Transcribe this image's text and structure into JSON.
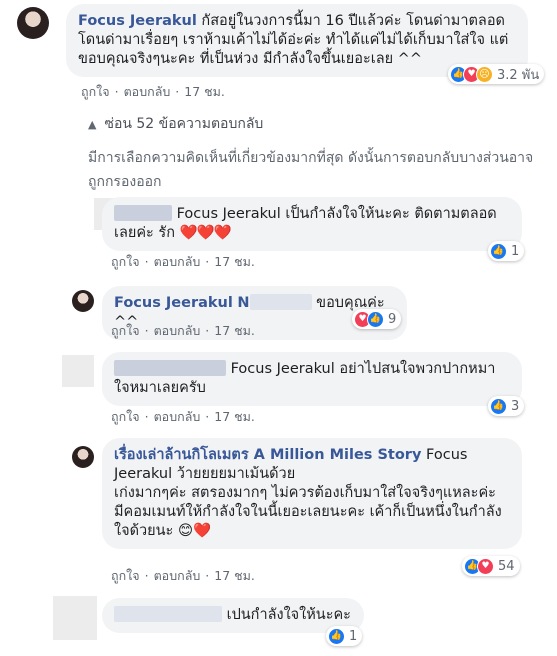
{
  "comment_main": {
    "author": "Focus Jeerakul",
    "text": "กัสอยู่ในวงการนี้มา 16 ปีแล้วค่ะ โดนด่ามาตลอด โดนด่ามาเรื่อยๆ เราห้ามเค้าไม่ได้อ่ะค่ะ ทำได้แค่ไม่ได้เก็บมาใส่ใจ แต่ขอบคุณจริงๆนะคะ ที่เป็นห่วง มีกำลังใจขึ้นเยอะเลย ^^",
    "reaction_count": "3.2 พัน",
    "like": "ถูกใจ",
    "reply": "ตอบกลับ",
    "time": "17 ชม."
  },
  "hidden_replies_link": "ซ่อน 52 ข้อความตอบกลับ",
  "notice": "มีการเลือกความคิดเห็นที่เกี่ยวข้องมากที่สุด ดังนั้นการตอบกลับบางส่วนอาจถูกกรองออก",
  "replies": [
    {
      "mention": "Focus Jeerakul",
      "text": "เป็นกำลังใจให้นะคะ ติดตามตลอดเลยค่ะ รัก",
      "hearts": "❤️❤️❤️",
      "reaction_count": "1",
      "like": "ถูกใจ",
      "reply": "ตอบกลับ",
      "time": "17 ชม."
    },
    {
      "author": "Focus Jeerakul",
      "author_initial": "N",
      "text": "ขอบคุณค่ะ ^^",
      "reaction_count": "9",
      "like": "ถูกใจ",
      "reply": "ตอบกลับ",
      "time": "17 ชม."
    },
    {
      "mention": "Focus Jeerakul",
      "text": "อย่าไปสนใจพวกปากหมาใจหมาเลยครับ",
      "reaction_count": "3",
      "like": "ถูกใจ",
      "reply": "ตอบกลับ",
      "time": "17 ชม."
    },
    {
      "author": "เรื่องเล่าล้านกิโลเมตร A Million Miles Story",
      "mention": "Focus Jeerakul",
      "line1": "ว้ายยยยมาเม้นด้วย",
      "line2": "เก่งมากๆค่ะ สตรองมากๆ ไม่ควรต้องเก็บมาใส่ใจจริงๆแหละค่ะ",
      "line3": "มีคอมเมนท์ให้กำลังใจในนี้เยอะเลยนะคะ เค้าก็เป็นหนึ่งในกำลังใจด้วยนะ",
      "emoji": "😊❤️",
      "reaction_count": "54",
      "like": "ถูกใจ",
      "reply": "ตอบกลับ",
      "time": "17 ชม."
    },
    {
      "text": "เปนกำลังใจให้นะคะ",
      "reaction_count": "1"
    }
  ],
  "colors": {
    "author": "#385898",
    "bubble": "#f2f3f5",
    "like": "#1877f2",
    "love": "#f33e58"
  },
  "icons": [
    "like-icon",
    "love-icon",
    "sad-icon",
    "chevron-up-icon"
  ]
}
